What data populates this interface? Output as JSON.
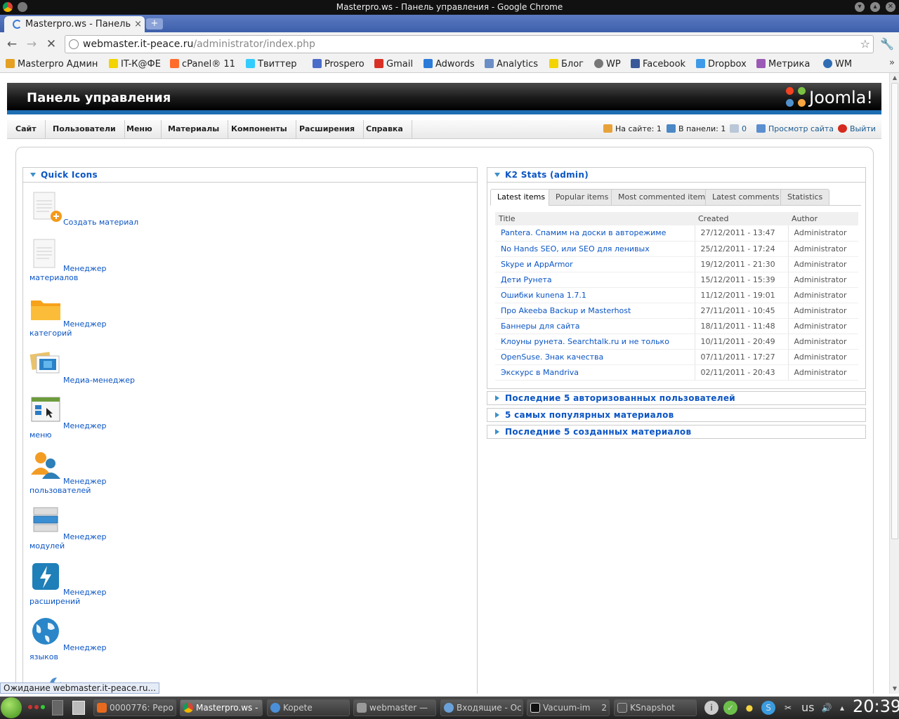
{
  "window": {
    "title": "Masterpro.ws - Панель управления - Google Chrome"
  },
  "browser": {
    "tab_title": "Masterpro.ws - Панель",
    "url_host": "webmaster.it-peace.ru",
    "url_path": "/administrator/index.php",
    "bookmarks": [
      "Masterpro Админ",
      "IT-К@ФЕ",
      "cPanel® 11",
      "Твиттер",
      "Prospero",
      "Gmail",
      "Adwords",
      "Analytics",
      "Блог",
      "WP",
      "Facebook",
      "Dropbox",
      "Метрика",
      "WM"
    ],
    "status": "Ожидание webmaster.it-peace.ru..."
  },
  "joomla": {
    "header_title": "Панель управления",
    "logo": "Joomla!",
    "menu": [
      "Сайт",
      "Пользователи",
      "Меню",
      "Материалы",
      "Компоненты",
      "Расширения",
      "Справка"
    ],
    "status_bar": {
      "on_site": "На сайте: 1",
      "in_panel": "В панели: 1",
      "messages": "0",
      "view_site": "Просмотр сайта",
      "logout": "Выйти"
    }
  },
  "quick_icons": {
    "title": "Quick Icons",
    "items": [
      {
        "l1": "Создать материал",
        "l2": "",
        "icon": "article-add-icon"
      },
      {
        "l1": "Менеджер",
        "l2": "материалов",
        "icon": "article-icon"
      },
      {
        "l1": "Менеджер",
        "l2": "категорий",
        "icon": "folder-icon"
      },
      {
        "l1": "Медиа-менеджер",
        "l2": "",
        "icon": "media-icon"
      },
      {
        "l1": "Менеджер",
        "l2": "меню",
        "icon": "menu-icon"
      },
      {
        "l1": "Менеджер",
        "l2": "пользователей",
        "icon": "users-icon"
      },
      {
        "l1": "Менеджер",
        "l2": "модулей",
        "icon": "modules-icon"
      },
      {
        "l1": "Менеджер",
        "l2": "расширений",
        "icon": "extensions-icon"
      },
      {
        "l1": "Менеджер",
        "l2": "языков",
        "icon": "languages-icon"
      }
    ]
  },
  "k2": {
    "title": "K2 Stats (admin)",
    "tabs": [
      "Latest items",
      "Popular items",
      "Most commented items",
      "Latest comments",
      "Statistics"
    ],
    "columns": [
      "Title",
      "Created",
      "Author"
    ],
    "rows": [
      [
        "Pantera. Спамим на доски в авторежиме",
        "27/12/2011 - 13:47",
        "Administrator"
      ],
      [
        "No Hands SEO, или SEO для ленивых",
        "25/12/2011 - 17:24",
        "Administrator"
      ],
      [
        "Skype и AppArmor",
        "19/12/2011 - 21:30",
        "Administrator"
      ],
      [
        "Дети Рунета",
        "15/12/2011 - 15:39",
        "Administrator"
      ],
      [
        "Ошибки kunena 1.7.1",
        "11/12/2011 - 19:01",
        "Administrator"
      ],
      [
        "Про Akeeba Backup и Masterhost",
        "27/11/2011 - 10:45",
        "Administrator"
      ],
      [
        "Баннеры для сайта",
        "18/11/2011 - 11:48",
        "Administrator"
      ],
      [
        "Клоуны рунета. Searchtalk.ru и не только",
        "10/11/2011 - 20:49",
        "Administrator"
      ],
      [
        "OpenSuse. Знак качества",
        "07/11/2011 - 17:27",
        "Administrator"
      ],
      [
        "Экскурс в Mandriva",
        "02/11/2011 - 20:43",
        "Administrator"
      ]
    ]
  },
  "collapsed_panels": [
    "Последние 5 авторизованных пользователей",
    "5 самых популярных материалов",
    "Последние 5 созданных материалов"
  ],
  "taskbar": {
    "tasks": [
      "0000776: Реро",
      "Masterpro.ws -",
      "Kopete",
      "webmaster —",
      "Входящие - Ос",
      "Vacuum-im",
      "KSnapshot"
    ],
    "vacuum_count": "2",
    "lang": "us",
    "clock": "20:39"
  }
}
